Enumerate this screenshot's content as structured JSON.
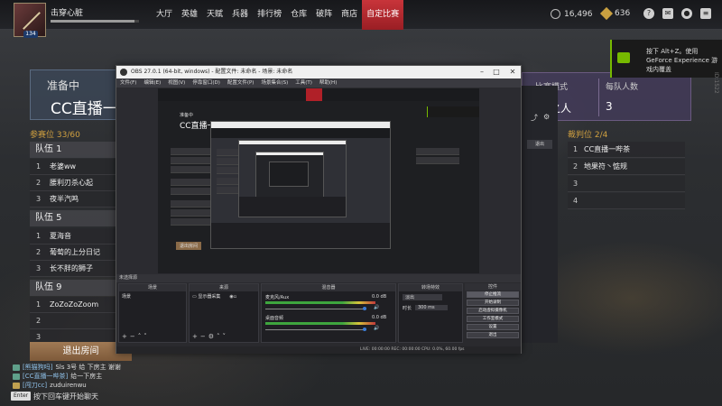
{
  "player": {
    "name": "击穿心脏",
    "level": "134",
    "xp_fraction": 0.95
  },
  "nav": {
    "items": [
      "大厅",
      "英雄",
      "天赋",
      "兵器",
      "排行榜",
      "仓库",
      "破阵",
      "商店",
      "自定比赛"
    ],
    "active_index": 8
  },
  "currency": {
    "coins": "16,496",
    "gems": "636"
  },
  "top_icons": [
    "help-icon",
    "mail-icon",
    "user-icon",
    "menu-icon"
  ],
  "room": {
    "status_label": "准备中",
    "room_name": "CC直播一",
    "mode_label": "比赛模式",
    "mode_value": "之人",
    "team_size_label": "每队人数",
    "team_size_value": "3",
    "seat_label": "参赛位 33/60",
    "judge_label": "裁判位 2/4"
  },
  "teams": [
    {
      "name": "队伍 1",
      "members": [
        {
          "num": "1",
          "name": "老婆ww"
        },
        {
          "num": "2",
          "name": "腰利刃杀心起"
        },
        {
          "num": "3",
          "name": "夜半汽鸣"
        }
      ]
    },
    {
      "name": "队伍 5",
      "members": [
        {
          "num": "1",
          "name": "夏海音"
        },
        {
          "num": "2",
          "name": "葡萄的上分日记"
        },
        {
          "num": "3",
          "name": "长不胖的狮子"
        }
      ]
    },
    {
      "name": "队伍 9",
      "members": [
        {
          "num": "1",
          "name": "ZoZoZoZoom"
        },
        {
          "num": "2",
          "name": ""
        },
        {
          "num": "3",
          "name": ""
        }
      ]
    }
  ],
  "judges": [
    {
      "num": "1",
      "name": "CC直播一哔茶"
    },
    {
      "num": "2",
      "name": "地果符丶惦规"
    },
    {
      "num": "3",
      "name": ""
    },
    {
      "num": "4",
      "name": ""
    }
  ],
  "exit_button": "退出房间",
  "chat": [
    {
      "tag": "[熊猫狗吗]",
      "text": "Sls 3号 给 下房主 谢谢"
    },
    {
      "tag": "[CC直播一哔茶]",
      "text": "给一下房主"
    },
    {
      "tag": "[闯刀cc]",
      "text": "zuduirenwu"
    }
  ],
  "chat_input": {
    "key": "Enter",
    "hint": "按下回车键开始聊天"
  },
  "toast": {
    "text": "按下 Alt+Z。使用 GeForce Experience 游戏内覆盖"
  },
  "side_text": "ID:1522",
  "obs": {
    "title": "OBS 27.0.1 (64-bit, windows) - 配置文件: 未命名 - 场景: 未命名",
    "menu": [
      "文件(F)",
      "编辑(E)",
      "视图(V)",
      "停靠窗口(D)",
      "配置文件(P)",
      "场景集合(S)",
      "工具(T)",
      "帮助(H)"
    ],
    "source_bar": "未选择源",
    "scenes_header": "场景",
    "scene_item": "场景",
    "sources_header": "来源",
    "source_item": "显示器采集",
    "mixer_header": "混音器",
    "audio1_name": "麦克风/Aux",
    "audio1_db": "0.0 dB",
    "audio2_name": "桌面音频",
    "audio2_db": "0.0 dB",
    "transition_header": "转场特效",
    "transition_value": "淡出",
    "duration_label": "时长",
    "duration_value": "300 ms",
    "controls_header": "控件",
    "controls": [
      "停止推流",
      "开始录制",
      "启动虚拟摄像机",
      "工作室模式",
      "设置",
      "退出"
    ],
    "status_text": "LIVE: 00:00:00   REC: 00:00:00   CPU: 0.0%, 60.00 fps",
    "nested_room": "CC直播一",
    "nested_status": "准备中",
    "nested_exit": "退出房间",
    "behind_button": "退出"
  }
}
